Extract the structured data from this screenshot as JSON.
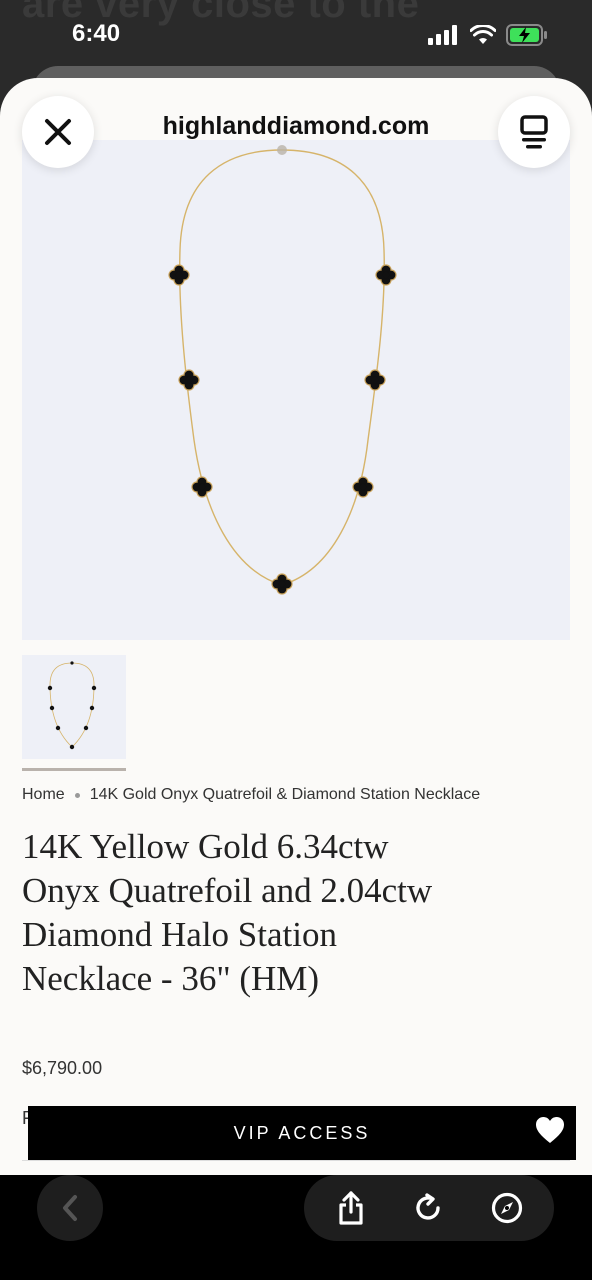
{
  "status": {
    "time": "6:40"
  },
  "background": {
    "ghost_line1": "are very close to the",
    "ghost_line2": ""
  },
  "browser": {
    "domain": "highlanddiamond.com"
  },
  "breadcrumb": {
    "home": "Home",
    "current": "14K Gold Onyx Quatrefoil & Diamond Station Necklace"
  },
  "product": {
    "title": "14K Yellow Gold 6.34ctw Onyx Quatrefoil and 2.04ctw Diamond Halo Station Necklace - 36\" (HM)",
    "price": "$6,790.00",
    "partial_label": "F"
  },
  "vip": {
    "label": "VIP ACCESS"
  },
  "icons": {
    "close": "close-icon",
    "menu": "reader-menu-icon",
    "back": "chevron-left-icon",
    "share": "share-icon",
    "reload": "reload-icon",
    "compass": "compass-icon",
    "heart": "heart-icon"
  },
  "colors": {
    "hero_bg": "#eef0f7",
    "gold": "#d6b46a",
    "onyx": "#111111"
  }
}
